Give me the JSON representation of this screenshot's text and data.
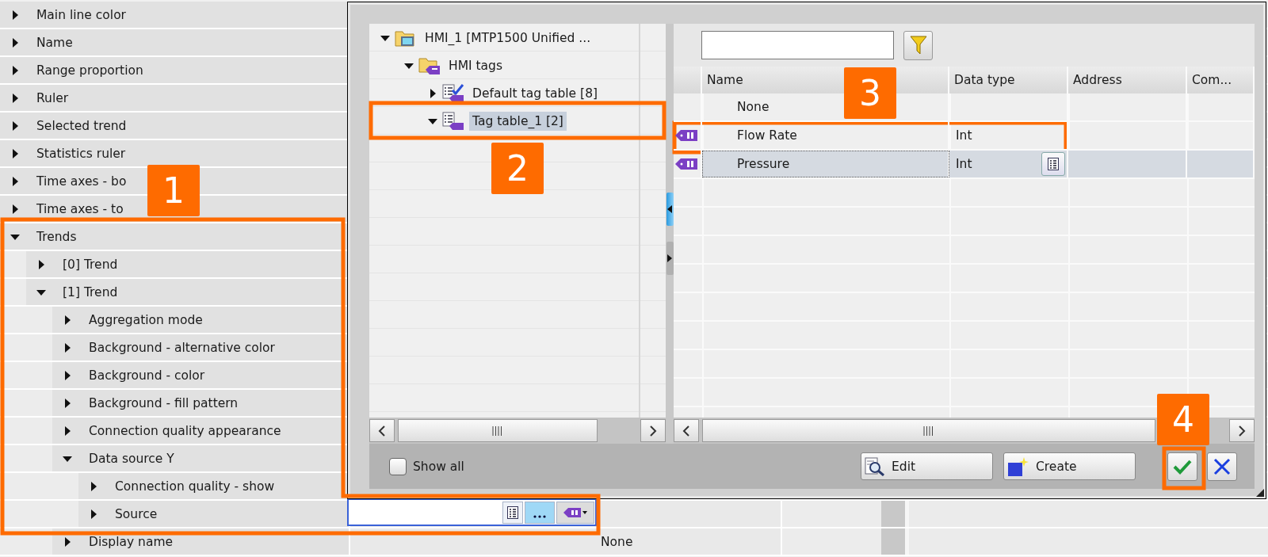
{
  "properties": [
    {
      "label": "Main line color",
      "expanded": false
    },
    {
      "label": "Name",
      "expanded": false
    },
    {
      "label": "Range proportion",
      "expanded": false
    },
    {
      "label": "Ruler",
      "expanded": false
    },
    {
      "label": "Selected trend",
      "expanded": false
    },
    {
      "label": "Statistics ruler",
      "expanded": false
    },
    {
      "label": "Time axes - bo",
      "expanded": false
    },
    {
      "label": "Time axes - to",
      "expanded": false
    },
    {
      "label": "Trends",
      "expanded": true,
      "children": [
        {
          "label": "[0] Trend",
          "expanded": false
        },
        {
          "label": "[1] Trend",
          "expanded": true,
          "children": [
            {
              "label": "Aggregation mode",
              "expanded": false
            },
            {
              "label": "Background - alternative color",
              "expanded": false
            },
            {
              "label": "Background - color",
              "expanded": false
            },
            {
              "label": "Background - fill pattern",
              "expanded": false
            },
            {
              "label": "Connection quality appearance",
              "expanded": false
            },
            {
              "label": "Data source Y",
              "expanded": true,
              "children": [
                {
                  "label": "Connection quality - show",
                  "expanded": false
                },
                {
                  "label": "Source",
                  "expanded": false,
                  "editing": true
                }
              ]
            },
            {
              "label": "Display name",
              "expanded": false,
              "value": "None"
            }
          ]
        }
      ]
    }
  ],
  "dialog": {
    "tree": [
      {
        "label": "HMI_1 [MTP1500 Unified ...",
        "kind": "device",
        "expanded": true,
        "selected": false,
        "children": [
          {
            "label": "HMI tags",
            "kind": "folder",
            "expanded": true,
            "selected": false,
            "children": [
              {
                "label": "Default tag table [8]",
                "kind": "checked-table",
                "expanded": false,
                "selected": false
              },
              {
                "label": "Tag table_1 [2]",
                "kind": "table",
                "expanded": true,
                "selected": true
              }
            ]
          }
        ]
      }
    ],
    "columns": [
      "Name",
      "Data type",
      "Address",
      "Com..."
    ],
    "rows": [
      {
        "kind": "none",
        "name": "None",
        "selected": false
      },
      {
        "kind": "tag",
        "name": "Flow Rate",
        "data_type": "Int",
        "selected": false
      },
      {
        "kind": "tag",
        "name": "Pressure",
        "data_type": "Int",
        "selected": true
      }
    ],
    "show_all": {
      "label": "Show all",
      "checked": false
    },
    "buttons": [
      {
        "label": "Edit",
        "kind": "edit"
      },
      {
        "label": "Create",
        "kind": "create"
      }
    ]
  },
  "callouts": [
    {
      "number": "1"
    },
    {
      "number": "2"
    },
    {
      "number": "3"
    },
    {
      "number": "4"
    }
  ]
}
